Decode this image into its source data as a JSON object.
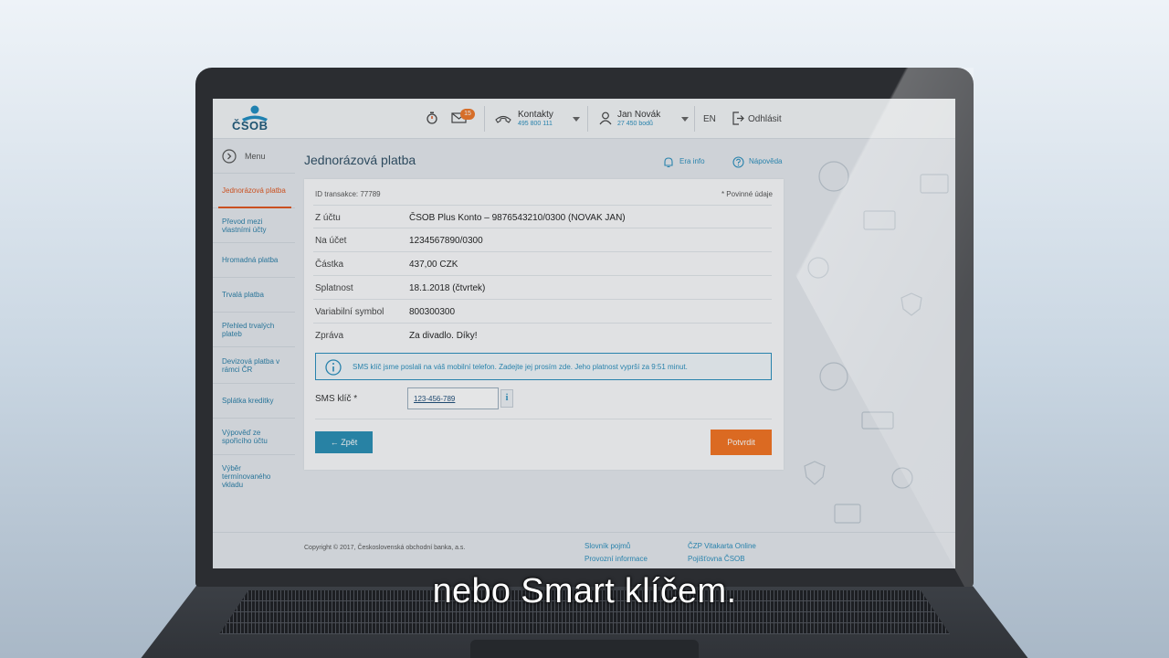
{
  "brand": {
    "logo_text": "ČSOB"
  },
  "topbar": {
    "notifications_count": "15",
    "contacts_label": "Kontakty",
    "contacts_phone": "495 800 111",
    "user_name": "Jan Novák",
    "user_points": "27 450 bodů",
    "language": "EN",
    "logout_label": "Odhlásit"
  },
  "sidebar": {
    "menu_label": "Menu",
    "items": [
      {
        "label": "Jednorázová platba",
        "active": true
      },
      {
        "label": "Převod mezi vlastními účty"
      },
      {
        "label": "Hromadná platba"
      },
      {
        "label": "Trvalá platba"
      },
      {
        "label": "Přehled trvalých plateb"
      },
      {
        "label": "Devizová platba v rámci ČR"
      },
      {
        "label": "Splátka kreditky"
      },
      {
        "label": "Výpověď ze spořicího účtu"
      },
      {
        "label": "Výběr termínovaného vkladu"
      }
    ]
  },
  "main": {
    "title": "Jednorázová platba",
    "era_info": "Era info",
    "help": "Nápověda",
    "transaction_id": "ID transakce: 77789",
    "required_note": "* Povinné údaje",
    "rows": [
      {
        "label": "Z účtu",
        "value": "ČSOB Plus Konto – 9876543210/0300 (NOVAK JAN)"
      },
      {
        "label": "Na účet",
        "value": "1234567890/0300"
      },
      {
        "label": "Částka",
        "value": "437,00 CZK"
      },
      {
        "label": "Splatnost",
        "value": "18.1.2018 (čtvrtek)"
      },
      {
        "label": "Variabilní symbol",
        "value": "800300300"
      },
      {
        "label": "Zpráva",
        "value": "Za divadlo. Díky!"
      }
    ],
    "sms_info": "SMS klíč jsme poslali na váš mobilní telefon. Zadejte jej prosím zde. Jeho platnost vyprší za 9:51 minut.",
    "sms_label": "SMS klíč *",
    "sms_value": "123-456-789",
    "back_label": "Zpět",
    "confirm_label": "Potvrdit"
  },
  "footer": {
    "copyright": "Copyright © 2017, Československá obchodní banka, a.s.",
    "links": [
      "Slovník pojmů",
      "Provozní informace",
      "ČZP Vitakarta Online",
      "Pojišťovna ČSOB"
    ]
  },
  "subtitle": "nebo Smart klíčem."
}
